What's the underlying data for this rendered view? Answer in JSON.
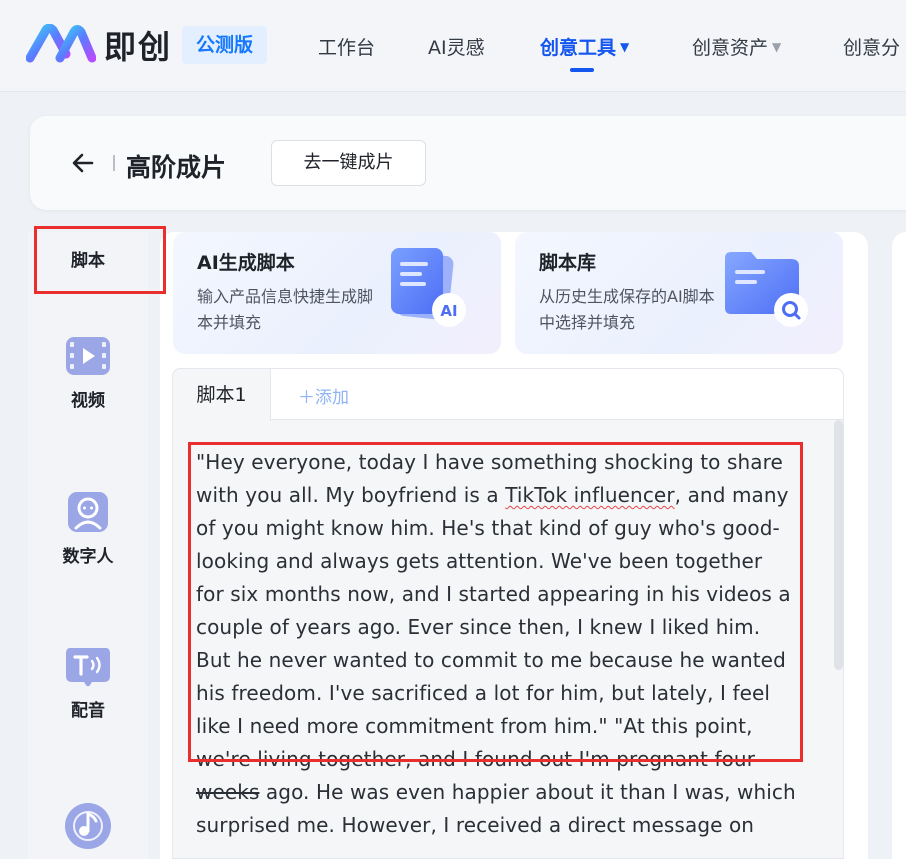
{
  "app": {
    "logo_text": "即创",
    "beta_badge": "公测版"
  },
  "nav": {
    "items": [
      {
        "label": "工作台",
        "has_arrow": false
      },
      {
        "label": "AI灵感",
        "has_arrow": false
      },
      {
        "label": "创意工具",
        "has_arrow": true,
        "active": true
      },
      {
        "label": "创意资产",
        "has_arrow": true
      },
      {
        "label": "创意分",
        "has_arrow": false
      }
    ],
    "arrow_glyph": "▼"
  },
  "header": {
    "back_icon": "arrow-left-icon",
    "title": "高阶成片",
    "one_click_button": "去一键成片"
  },
  "sidebar": {
    "items": [
      {
        "label": "脚本",
        "icon": null,
        "active": true
      },
      {
        "label": "视频",
        "icon": "video-icon"
      },
      {
        "label": "数字人",
        "icon": "digital-human-icon"
      },
      {
        "label": "配音",
        "icon": "voiceover-icon"
      },
      {
        "label": "",
        "icon": "music-icon"
      }
    ]
  },
  "cards": {
    "ai_script": {
      "title": "AI生成脚本",
      "desc": "输入产品信息快捷生成脚本并填充",
      "badge": "AI"
    },
    "script_library": {
      "title": "脚本库",
      "desc": "从历史生成保存的AI脚本中选择并填充"
    }
  },
  "tabs": {
    "active_tab": "脚本1",
    "add_label": "＋添加"
  },
  "script": {
    "before_underline": "\"Hey everyone, today I have something shocking to share with you all. My boyfriend is a ",
    "underlined": "TikTok influencer",
    "after_underline": ", and many of you might know him. He's that kind of guy who's good-looking and always gets attention. We've been together for six months now, and I started appearing in his videos a couple of years ago. Ever since then, I knew I liked him. But he never wanted to commit to me because he wanted his freedom. I've sacrificed a lot for him, but lately, I feel like I need more commitment from him.\" \"At this point, we're ",
    "struck": "living together, and I found out I'm pregnant four weeks",
    "tail": " ago. He was even happier about it than I was, which surprised me. However, I received a direct message on"
  },
  "colors": {
    "accent": "#1456f0",
    "highlight": "#ea2e2e",
    "beta_bg": "#e3efff"
  }
}
